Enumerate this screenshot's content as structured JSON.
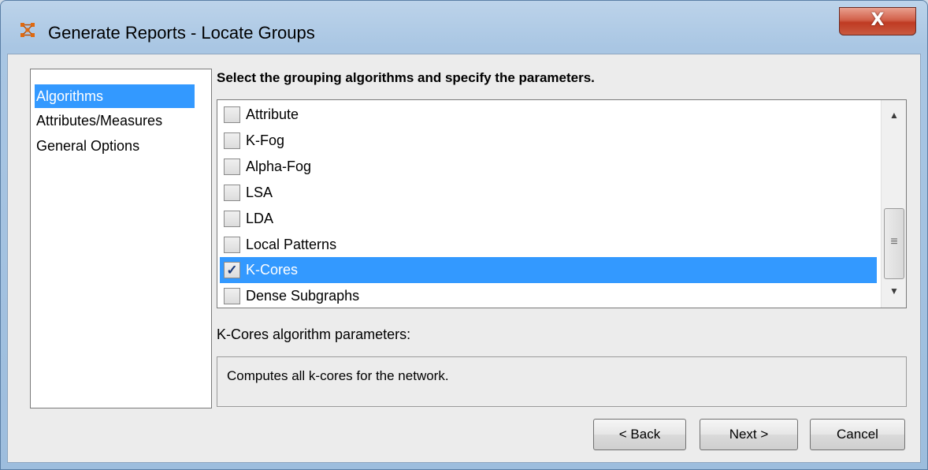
{
  "window": {
    "title": "Generate Reports - Locate Groups",
    "close_label": "X"
  },
  "nav": {
    "items": [
      {
        "label": "Algorithms",
        "selected": true
      },
      {
        "label": "Attributes/Measures",
        "selected": false
      },
      {
        "label": "General Options",
        "selected": false
      }
    ]
  },
  "main": {
    "heading": "Select the grouping algorithms and specify the parameters.",
    "algorithms": [
      {
        "label": "Attribute",
        "checked": false,
        "selected": false
      },
      {
        "label": "K-Fog",
        "checked": false,
        "selected": false
      },
      {
        "label": "Alpha-Fog",
        "checked": false,
        "selected": false
      },
      {
        "label": "LSA",
        "checked": false,
        "selected": false
      },
      {
        "label": "LDA",
        "checked": false,
        "selected": false
      },
      {
        "label": "Local Patterns",
        "checked": false,
        "selected": false
      },
      {
        "label": "K-Cores",
        "checked": true,
        "selected": true
      },
      {
        "label": "Dense Subgraphs",
        "checked": false,
        "selected": false
      }
    ],
    "params_label": "K-Cores algorithm parameters:",
    "params_text": "Computes all k-cores for the network."
  },
  "buttons": {
    "back_label": "< Back",
    "next_label": "Next >",
    "cancel_label": "Cancel"
  },
  "colors": {
    "selection": "#3399ff",
    "close_button": "#c9452c",
    "app_icon": "#e06a10"
  },
  "icons": {
    "app": "app-logo-icon",
    "close": "close-icon",
    "check": "checkmark-icon",
    "scroll_up": "arrow-up-icon",
    "scroll_down": "arrow-down-icon",
    "grip": "scroll-grip-icon"
  }
}
